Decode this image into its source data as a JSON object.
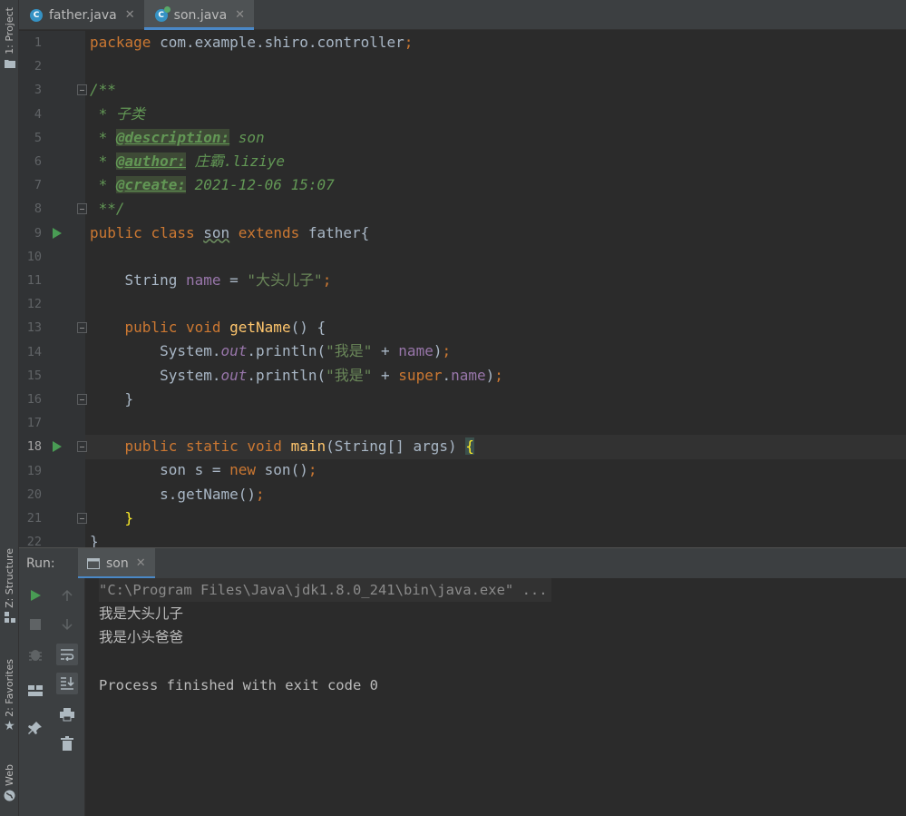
{
  "left_stripe": {
    "project": "1: Project",
    "structure": "Z: Structure",
    "favorites": "2: Favorites",
    "web": "Web"
  },
  "tabs": [
    {
      "label": "father.java",
      "icon": "class-icon",
      "active": false
    },
    {
      "label": "son.java",
      "icon": "class-run-icon",
      "active": true
    }
  ],
  "editor": {
    "line_numbers": [
      "1",
      "2",
      "3",
      "4",
      "5",
      "6",
      "7",
      "8",
      "9",
      "10",
      "11",
      "12",
      "13",
      "14",
      "15",
      "16",
      "17",
      "18",
      "19",
      "20",
      "21",
      "22"
    ],
    "current_line": "18",
    "lines": {
      "l1": {
        "kw": "package",
        "rest": " com.example.shiro.controller",
        "semi": ";"
      },
      "l3": "/**",
      "l4": " * 子类",
      "l5": {
        "star": " * ",
        "tag": "@description:",
        "val": " son"
      },
      "l6": {
        "star": " * ",
        "tag": "@author:",
        "val": " 庄霸.liziye"
      },
      "l7": {
        "star": " * ",
        "tag": "@create:",
        "val": " 2021-12-06 15:07"
      },
      "l8": " **/",
      "l9": {
        "kw1": "public",
        "kw2": "class",
        "name": "son",
        "kw3": "extends",
        "rest": " father{"
      },
      "l11": {
        "type": "    String ",
        "field": "name",
        "eq": " = ",
        "str": "\"大头儿子\"",
        "semi": ";"
      },
      "l13": {
        "kw1": "    public",
        "kw2": "void",
        "fn": "getName",
        "rest": "() {"
      },
      "l14": {
        "a": "        System.",
        "out": "out",
        "b": ".println(",
        "str": "\"我是\"",
        "c": " + ",
        "field": "name",
        "d": ")",
        "semi": ";"
      },
      "l15": {
        "a": "        System.",
        "out": "out",
        "b": ".println(",
        "str": "\"我是\"",
        "c": " + ",
        "kw": "super",
        "dot": ".",
        "field": "name",
        "d": ")",
        "semi": ";"
      },
      "l16": "    }",
      "l18": {
        "kw1": "    public",
        "kw2": "static",
        "kw3": "void",
        "fn": "main",
        "rest": "(String[] args) ",
        "brace": "{"
      },
      "l19": {
        "a": "        son s = ",
        "kw": "new",
        "b": " son()",
        "semi": ";"
      },
      "l20": {
        "a": "        s.getName()",
        "semi": ";"
      },
      "l21": {
        "brace": "    }"
      },
      "l22": "}"
    }
  },
  "run": {
    "label": "Run:",
    "tab": "son",
    "console": [
      "\"C:\\Program Files\\Java\\jdk1.8.0_241\\bin\\java.exe\" ...",
      "我是大头儿子",
      "我是小头爸爸",
      "",
      "Process finished with exit code 0"
    ]
  },
  "colors": {
    "accent": "#4a88c7",
    "run_green": "#499c54",
    "keyword": "#cc7832",
    "string": "#6a8759",
    "field": "#9876aa",
    "function": "#ffc66d"
  }
}
